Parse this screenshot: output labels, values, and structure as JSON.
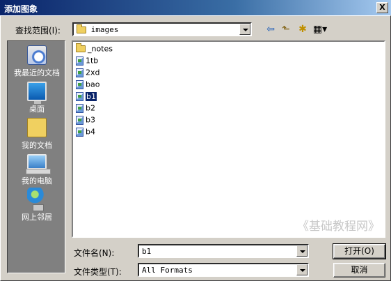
{
  "window": {
    "title": "添加图象",
    "close_label": "X"
  },
  "lookin": {
    "label": "查找范围(I):",
    "value": "images"
  },
  "toolbar": {
    "back": "⇦",
    "up": "⬑",
    "newfolder": "✱",
    "views": "▦▾"
  },
  "places": [
    {
      "label": "我最近的文档",
      "icon": "recent-documents-icon"
    },
    {
      "label": "桌面",
      "icon": "desktop-icon"
    },
    {
      "label": "我的文档",
      "icon": "my-documents-icon"
    },
    {
      "label": "我的电脑",
      "icon": "my-computer-icon"
    },
    {
      "label": "网上邻居",
      "icon": "network-icon"
    }
  ],
  "files": [
    {
      "name": "_notes",
      "type": "folder"
    },
    {
      "name": "1tb",
      "type": "image"
    },
    {
      "name": "2xd",
      "type": "image"
    },
    {
      "name": "bao",
      "type": "image"
    },
    {
      "name": "b1",
      "type": "image",
      "selected": true
    },
    {
      "name": "b2",
      "type": "image"
    },
    {
      "name": "b3",
      "type": "image"
    },
    {
      "name": "b4",
      "type": "image"
    }
  ],
  "watermark": "《基础教程网》",
  "filename": {
    "label": "文件名(N):",
    "value": "b1"
  },
  "filetype": {
    "label": "文件类型(T):",
    "value": "All Formats"
  },
  "buttons": {
    "open": "打开(O)",
    "cancel": "取消"
  }
}
